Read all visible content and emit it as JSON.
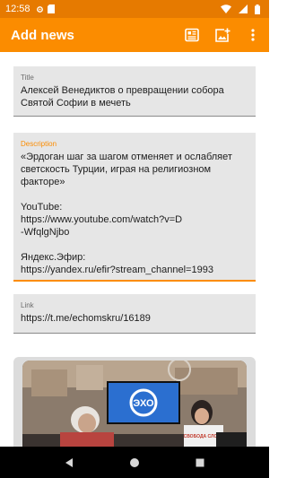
{
  "status_bar": {
    "time": "12:58",
    "icons": [
      "settings-icon",
      "sd-card-icon",
      "wifi-icon",
      "signal-icon",
      "battery-icon"
    ]
  },
  "app_bar": {
    "title": "Add news",
    "actions": [
      "news-list-icon",
      "add-image-icon",
      "more-vert-icon"
    ],
    "background": "#fb8c00"
  },
  "form": {
    "title_field": {
      "label": "Title",
      "value": "Алексей Венедиктов о превращении собора Святой Софии в мечеть"
    },
    "description_field": {
      "label": "Description",
      "value": "«Эрдоган шаг за шагом отменяет и ослабляет светскость Турции, играя на религиозном факторе»\n\nYouTube:\nhttps://www.youtube.com/watch?v=D\n-WfqlgNjbo\n\nЯндекс.Эфир:\nhttps://yandex.ru/efir?stream_channel=1993"
    },
    "link_field": {
      "label": "Link",
      "value": "https://t.me/echomskru/16189"
    }
  },
  "preview": {
    "logo_text": "ЭХО",
    "shirt_text": "СВОБОДА СЛОВА"
  },
  "nav_bar": {
    "buttons": [
      "back-icon",
      "home-icon",
      "recents-icon"
    ]
  },
  "colors": {
    "accent": "#fb8c00",
    "status_bar": "#e67a00",
    "field_bg": "#e6e6e6"
  }
}
